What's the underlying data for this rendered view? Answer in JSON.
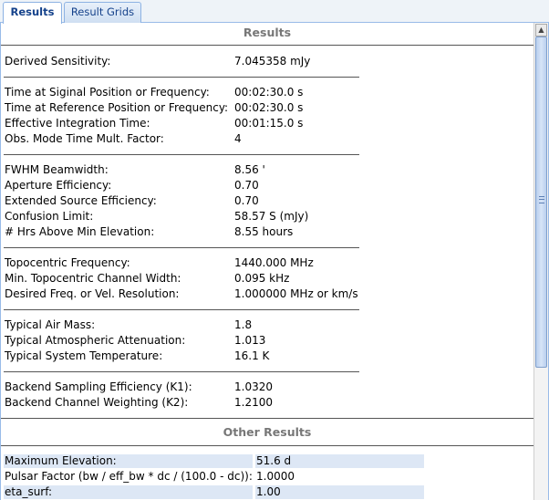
{
  "tabs": [
    "Results",
    "Result Grids"
  ],
  "sections": {
    "results_title": "Results",
    "other_title": "Other Results"
  },
  "rows": {
    "derived_sensitivity": {
      "label": "Derived Sensitivity:",
      "value": "7.045358 mJy"
    },
    "time_signal": {
      "label": "Time at Siginal Position or Frequency:",
      "value": "00:02:30.0 s"
    },
    "time_reference": {
      "label": "Time at Reference Position or Frequency:",
      "value": "00:02:30.0 s"
    },
    "effective_integration": {
      "label": "Effective Integration Time:",
      "value": "00:01:15.0 s"
    },
    "obs_mode_factor": {
      "label": "Obs. Mode Time Mult. Factor:",
      "value": "4"
    },
    "fwhm": {
      "label": "FWHM Beamwidth:",
      "value": "8.56 '"
    },
    "aperture_eff": {
      "label": "Aperture Efficiency:",
      "value": "0.70"
    },
    "extended_eff": {
      "label": "Extended Source Efficiency:",
      "value": "0.70"
    },
    "confusion_limit": {
      "label": "Confusion Limit:",
      "value": "58.57 S (mJy)"
    },
    "hrs_above_min": {
      "label": "# Hrs Above Min Elevation:",
      "value": "8.55 hours"
    },
    "topo_freq": {
      "label": "Topocentric Frequency:",
      "value": "1440.000 MHz"
    },
    "min_channel_width": {
      "label": "Min. Topocentric Channel Width:",
      "value": "0.095 kHz"
    },
    "desired_resolution": {
      "label": "Desired Freq. or Vel. Resolution:",
      "value": "1.000000 MHz or km/s"
    },
    "air_mass": {
      "label": "Typical Air Mass:",
      "value": "1.8"
    },
    "atm_attenuation": {
      "label": "Typical Atmospheric Attenuation:",
      "value": "1.013"
    },
    "system_temp": {
      "label": "Typical System Temperature:",
      "value": "16.1 K"
    },
    "backend_k1": {
      "label": "Backend Sampling Efficiency (K1):",
      "value": "1.0320"
    },
    "backend_k2": {
      "label": "Backend Channel Weighting (K2):",
      "value": "1.2100"
    }
  },
  "other": [
    {
      "label": "Maximum Elevation:",
      "value": "51.6 d"
    },
    {
      "label": "Pulsar Factor (bw / eff_bw * dc / (100.0 - dc)):",
      "value": "1.0000"
    },
    {
      "label": "eta_surf:",
      "value": "1.00"
    }
  ],
  "scrollbar": {
    "up_icon": "▲"
  }
}
